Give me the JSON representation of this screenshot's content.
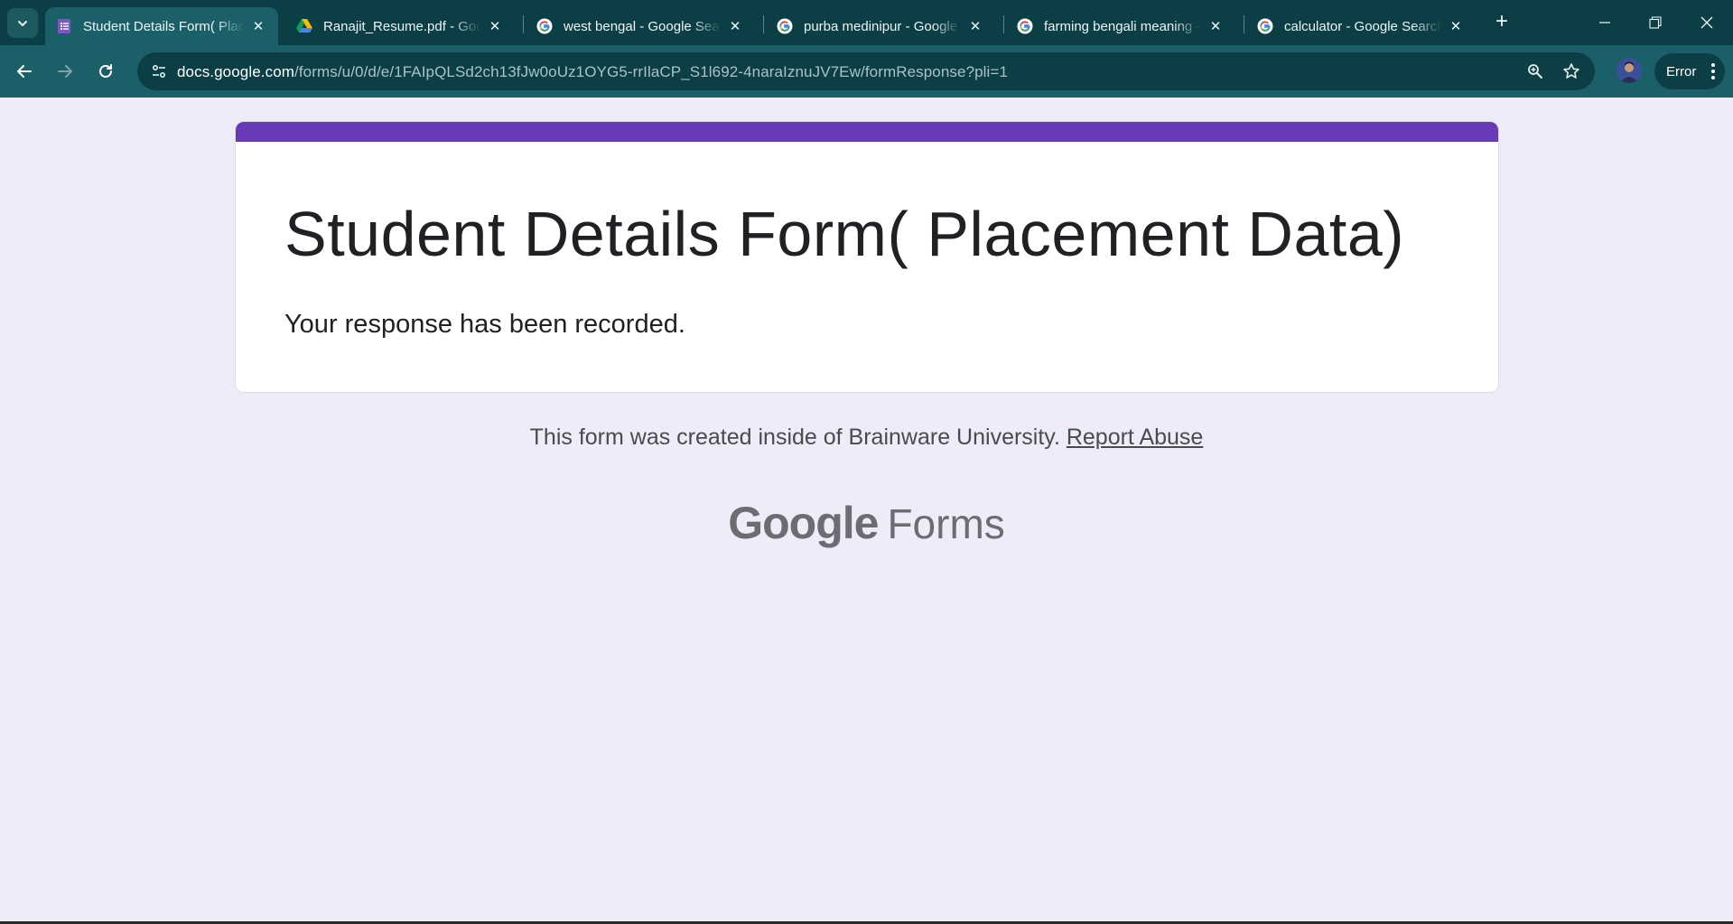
{
  "browser": {
    "tabs": [
      {
        "title": "Student Details Form( Placement Data)",
        "favicon": "google-forms-icon",
        "active": true
      },
      {
        "title": "Ranajit_Resume.pdf - Google Drive",
        "favicon": "google-drive-icon",
        "active": false
      },
      {
        "title": "west bengal - Google Search",
        "favicon": "google-g-icon",
        "active": false
      },
      {
        "title": "purba medinipur - Google Search",
        "favicon": "google-g-icon",
        "active": false
      },
      {
        "title": "farming bengali meaning - Google Search",
        "favicon": "google-g-icon",
        "active": false
      },
      {
        "title": "calculator - Google Search",
        "favicon": "google-g-icon",
        "active": false
      }
    ],
    "address_bar": {
      "host": "docs.google.com",
      "path": "/forms/u/0/d/e/1FAIpQLSd2ch13fJw0oUz1OYG5-rrIlaCP_S1l692-4naraIznuJV7Ew/formResponse?pli=1"
    },
    "profile_status": "Error",
    "colors": {
      "tabbar": "#0b3f45",
      "toolbar": "#1b6068",
      "page_background": "#efebf8",
      "form_accent": "#673ab7"
    }
  },
  "page": {
    "form_title": "Student Details Form( Placement Data)",
    "confirmation": "Your response has been recorded.",
    "footer_text": "This form was created inside of Brainware University.",
    "report_link": "Report Abuse",
    "brand_google": "Google",
    "brand_forms": "Forms"
  }
}
